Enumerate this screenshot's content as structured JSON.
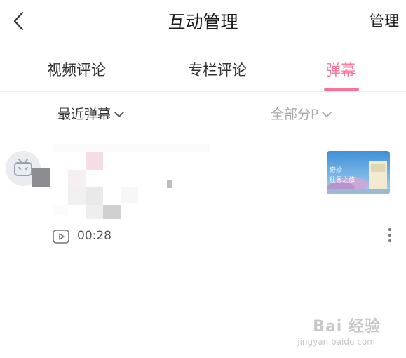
{
  "header": {
    "title": "互动管理",
    "manage_label": "管理",
    "back_icon": "chevron-left-icon"
  },
  "tabs": [
    {
      "label": "视频评论",
      "active": false
    },
    {
      "label": "专栏评论",
      "active": false
    },
    {
      "label": "弹幕",
      "active": true
    }
  ],
  "filters": {
    "sort_label": "最近弹幕",
    "part_label": "全部分P"
  },
  "item": {
    "duration": "00:28",
    "thumbnail_text_1": "奇妙",
    "thumbnail_text_2": "往恩之旅"
  },
  "watermark": {
    "brand": "Bai 经验",
    "url": "jingyan.baidu.com"
  },
  "colors": {
    "accent": "#fb7299",
    "divider": "#ececec",
    "text": "#212121",
    "muted": "#999999"
  }
}
